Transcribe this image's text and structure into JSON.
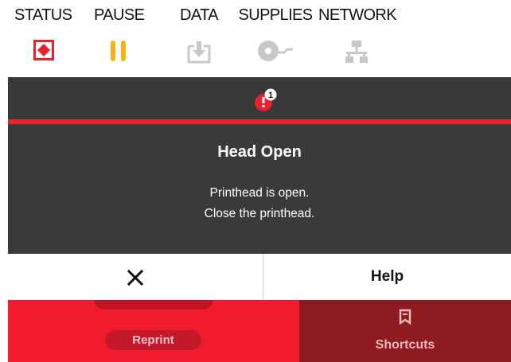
{
  "indicators": {
    "status": "STATUS",
    "pause": "PAUSE",
    "data": "DATA",
    "supplies": "SUPPLIES",
    "network": "NETWORK"
  },
  "alert": {
    "count": "1",
    "title": "Head Open",
    "line1": "Printhead is open.",
    "line2": "Close the printhead."
  },
  "buttons": {
    "help": "Help",
    "reprint": "Reprint",
    "shortcuts": "Shortcuts"
  },
  "icons": {
    "status": "status-alert-icon",
    "pause": "pause-icon",
    "data": "data-download-icon",
    "supplies": "supplies-roll-icon",
    "network": "network-icon",
    "alert": "alert-badge-icon",
    "close": "close-icon",
    "shortcuts": "bookmark-icon"
  },
  "colors": {
    "status_red": "#e8212f",
    "pause_yellow": "#f5b40f",
    "inactive_gray": "#c8c8c8",
    "screen_dark": "#3a3a3a",
    "button_red": "#f01c2e",
    "button_dark_red": "#8e1a22"
  }
}
